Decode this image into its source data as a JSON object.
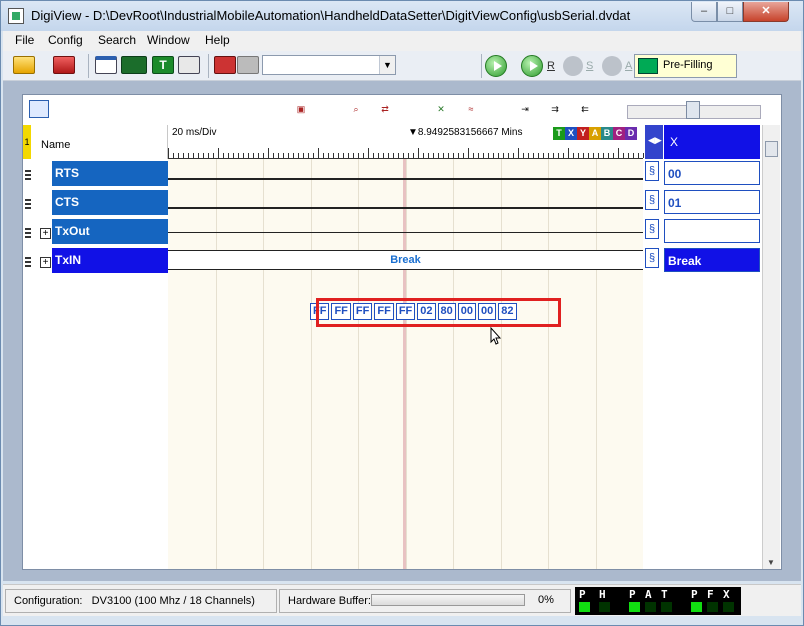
{
  "window": {
    "title": "DigiView - D:\\DevRoot\\IndustrialMobileAutomation\\HandheldDataSetter\\DigitViewConfig\\usbSerial.dvdat",
    "controls": {
      "minimize": "–",
      "maximize": "□",
      "close": "✕"
    }
  },
  "menu": {
    "items": [
      "File",
      "Config",
      "Search",
      "Window",
      "Help"
    ]
  },
  "toolbar": {
    "combo_value": "",
    "run_r": "R",
    "run_s": "S",
    "run_a": "A",
    "status_text": "Pre-Filling",
    "led_color": "#00aa55"
  },
  "waveform": {
    "name_header": "Name",
    "header_marker": "1",
    "time_scale": "20 ms/Div",
    "cursor_time": "8.9492583156667 Mins",
    "channel_badges": [
      {
        "label": "T",
        "color": "#1a9a1a"
      },
      {
        "label": "X",
        "color": "#1f4fc0"
      },
      {
        "label": "Y",
        "color": "#c21f1f"
      },
      {
        "label": "A",
        "color": "#d8a000"
      },
      {
        "label": "B",
        "color": "#2a8a8a"
      },
      {
        "label": "C",
        "color": "#a02080"
      },
      {
        "label": "D",
        "color": "#6a2cae"
      }
    ],
    "value_header": "X",
    "channels": [
      {
        "name": "RTS",
        "value": "00"
      },
      {
        "name": "CTS",
        "value": "01"
      },
      {
        "name": "TxOut",
        "value": "",
        "expand": "+"
      },
      {
        "name": "TxIN",
        "value": "Break",
        "expand": "+"
      }
    ],
    "txout_bytes": [
      "FF",
      "FF",
      "FF",
      "FF",
      "FF",
      "02",
      "80",
      "00",
      "00",
      "82"
    ],
    "txin_label": "Break",
    "s_icon": "§"
  },
  "statusbar": {
    "configuration_label": "Configuration:",
    "configuration_value": "DV3100 (100 Mhz / 18 Channels)",
    "buffer_label": "Hardware Buffer:",
    "buffer_percent": "0%",
    "buffer_fraction": 0.0,
    "led_letters": [
      "P",
      "H",
      "P",
      "A",
      "T",
      "P",
      "F",
      "X"
    ],
    "led_states": [
      true,
      false,
      true,
      false,
      false,
      true,
      false,
      false
    ],
    "led_on_color": "#11dd11"
  }
}
